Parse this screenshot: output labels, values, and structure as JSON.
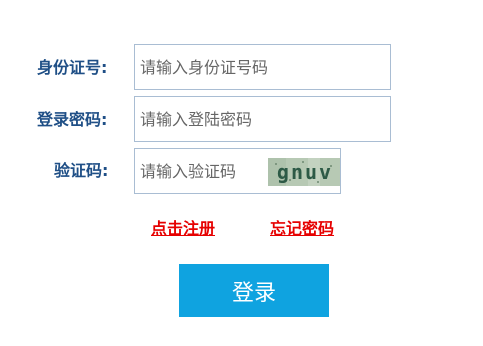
{
  "form": {
    "id_label": "身份证号:",
    "id_placeholder": "请输入身份证号码",
    "password_label": "登录密码:",
    "password_placeholder": "请输入登陆密码",
    "captcha_label": "验证码:",
    "captcha_placeholder": "请输入验证码",
    "captcha_image_text": "gnuv"
  },
  "links": {
    "register": "点击注册",
    "forgot_password": "忘记密码"
  },
  "login_button": "登录",
  "colors": {
    "label": "#1f4f86",
    "link": "#e60000",
    "button": "#0fa3e0"
  },
  "icons": {
    "captcha": "captcha-image"
  }
}
